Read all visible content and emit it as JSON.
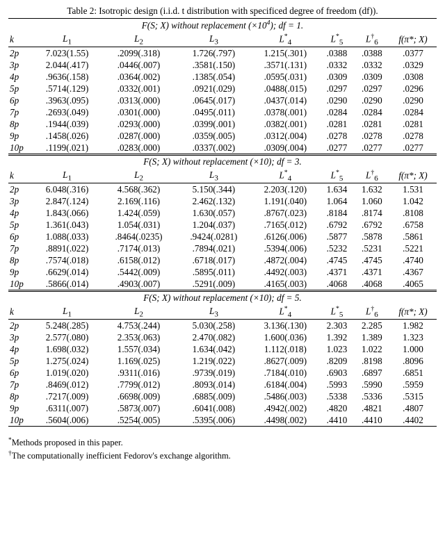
{
  "caption": "Table 2: Isotropic design (i.i.d. t distribution with specificed degree of freedom (df)).",
  "section_titles": {
    "s1_a": "F(S; X) without replacement (×10",
    "s1_b": "4",
    "s1_c": "); df = 1.",
    "s2": "F(S; X) without replacement (×10); df = 3.",
    "s3": "F(S; X) without replacement (×10); df = 5."
  },
  "headers": {
    "k": "k",
    "L1": "L",
    "L1s": "1",
    "L2": "L",
    "L2s": "2",
    "L3": "L",
    "L3s": "3",
    "L4": "L",
    "L4s": "4",
    "L4sup": "*",
    "L5": "L",
    "L5s": "5",
    "L5sup": "*",
    "L6": "L",
    "L6s": "6",
    "L6sup": "†",
    "f": "f(π*; X)"
  },
  "footnotes": {
    "star": "*",
    "star_text": "Methods proposed in this paper.",
    "dagger": "†",
    "dagger_text": "The computationally inefficient Fedorov's exchange algorithm."
  },
  "chart_data": {
    "type": "table",
    "kcol": [
      "2p",
      "3p",
      "4p",
      "5p",
      "6p",
      "7p",
      "8p",
      "9p",
      "10p"
    ],
    "sections": [
      {
        "df": 1,
        "scale": "×10^4",
        "rows": [
          [
            "7.023(1.55)",
            ".2099(.318)",
            "1.726(.797)",
            "1.215(.301)",
            ".0388",
            ".0388",
            ".0377"
          ],
          [
            "2.044(.417)",
            ".0446(.007)",
            ".3581(.150)",
            ".3571(.131)",
            ".0332",
            ".0332",
            ".0329"
          ],
          [
            ".9636(.158)",
            ".0364(.002)",
            ".1385(.054)",
            ".0595(.031)",
            ".0309",
            ".0309",
            ".0308"
          ],
          [
            ".5714(.129)",
            ".0332(.001)",
            ".0921(.029)",
            ".0488(.015)",
            ".0297",
            ".0297",
            ".0296"
          ],
          [
            ".3963(.095)",
            ".0313(.000)",
            ".0645(.017)",
            ".0437(.014)",
            ".0290",
            ".0290",
            ".0290"
          ],
          [
            ".2693(.049)",
            ".0301(.000)",
            ".0495(.011)",
            ".0378(.001)",
            ".0284",
            ".0284",
            ".0284"
          ],
          [
            ".1944(.039)",
            ".0293(.000)",
            ".0399(.001)",
            ".0382(.001)",
            ".0281",
            ".0281",
            ".0281"
          ],
          [
            ".1458(.026)",
            ".0287(.000)",
            ".0359(.005)",
            ".0312(.004)",
            ".0278",
            ".0278",
            ".0278"
          ],
          [
            ".1199(.021)",
            ".0283(.000)",
            ".0337(.002)",
            ".0309(.004)",
            ".0277",
            ".0277",
            ".0277"
          ]
        ]
      },
      {
        "df": 3,
        "scale": "×10",
        "rows": [
          [
            "6.048(.316)",
            "4.568(.362)",
            "5.150(.344)",
            "2.203(.120)",
            "1.634",
            "1.632",
            "1.531"
          ],
          [
            "2.847(.124)",
            "2.169(.116)",
            "2.462(.132)",
            "1.191(.040)",
            "1.064",
            "1.060",
            "1.042"
          ],
          [
            "1.843(.066)",
            "1.424(.059)",
            "1.630(.057)",
            ".8767(.023)",
            ".8184",
            ".8174",
            ".8108"
          ],
          [
            "1.361(.043)",
            "1.054(.031)",
            "1.204(.037)",
            ".7165(.012)",
            ".6792",
            ".6792",
            ".6758"
          ],
          [
            "1.088(.033)",
            ".8464(.0235)",
            ".9424(.0281)",
            ".6126(.006)",
            ".5877",
            ".5878",
            ".5861"
          ],
          [
            ".8891(.022)",
            ".7174(.013)",
            ".7894(.021)",
            ".5394(.006)",
            ".5232",
            ".5231",
            ".5221"
          ],
          [
            ".7574(.018)",
            ".6158(.012)",
            ".6718(.017)",
            ".4872(.004)",
            ".4745",
            ".4745",
            ".4740"
          ],
          [
            ".6629(.014)",
            ".5442(.009)",
            ".5895(.011)",
            ".4492(.003)",
            ".4371",
            ".4371",
            ".4367"
          ],
          [
            ".5866(.014)",
            ".4903(.007)",
            ".5291(.009)",
            ".4165(.003)",
            ".4068",
            ".4068",
            ".4065"
          ]
        ]
      },
      {
        "df": 5,
        "scale": "×10",
        "rows": [
          [
            "5.248(.285)",
            "4.753(.244)",
            "5.030(.258)",
            "3.136(.130)",
            "2.303",
            "2.285",
            "1.982"
          ],
          [
            "2.577(.080)",
            "2.353(.063)",
            "2.470(.082)",
            "1.600(.036)",
            "1.392",
            "1.389",
            "1.323"
          ],
          [
            "1.698(.032)",
            "1.557(.034)",
            "1.634(.042)",
            "1.112(.018)",
            "1.023",
            "1.022",
            "1.000"
          ],
          [
            "1.275(.024)",
            "1.169(.025)",
            "1.219(.022)",
            ".8627(.009)",
            ".8209",
            ".8198",
            ".8096"
          ],
          [
            "1.019(.020)",
            ".9311(.016)",
            ".9739(.019)",
            ".7184(.010)",
            ".6903",
            ".6897",
            ".6851"
          ],
          [
            ".8469(.012)",
            ".7799(.012)",
            ".8093(.014)",
            ".6184(.004)",
            ".5993",
            ".5990",
            ".5959"
          ],
          [
            ".7217(.009)",
            ".6698(.009)",
            ".6885(.009)",
            ".5486(.003)",
            ".5338",
            ".5336",
            ".5315"
          ],
          [
            ".6311(.007)",
            ".5873(.007)",
            ".6041(.008)",
            ".4942(.002)",
            ".4820",
            ".4821",
            ".4807"
          ],
          [
            ".5604(.006)",
            ".5254(.005)",
            ".5395(.006)",
            ".4498(.002)",
            ".4410",
            ".4410",
            ".4402"
          ]
        ]
      }
    ]
  }
}
